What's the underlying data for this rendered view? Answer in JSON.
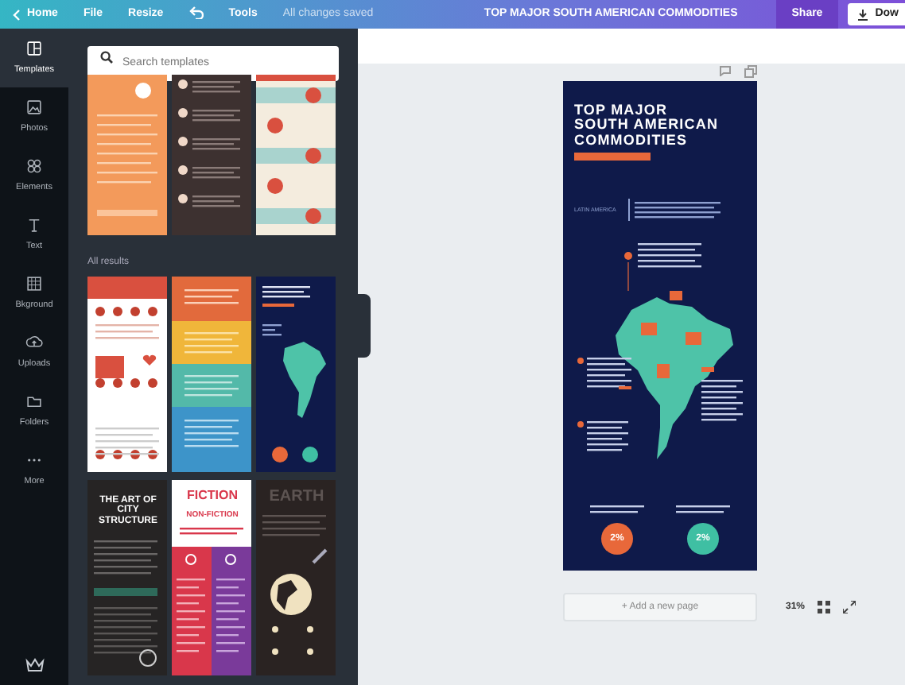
{
  "top_bar": {
    "back": "Home",
    "menu": [
      "File",
      "Resize"
    ],
    "tools": "Tools",
    "save_status": "All changes saved",
    "title": "TOP MAJOR SOUTH AMERICAN COMMODITIES",
    "share": "Share",
    "download": "Dow"
  },
  "sidebar": {
    "items": [
      {
        "label": "Templates",
        "kind": "templates",
        "selected": true
      },
      {
        "label": "Photos",
        "kind": "photos",
        "selected": false
      },
      {
        "label": "Elements",
        "kind": "elements",
        "selected": false
      },
      {
        "label": "Text",
        "kind": "text",
        "selected": false
      },
      {
        "label": "Bkground",
        "kind": "background",
        "selected": false
      },
      {
        "label": "Uploads",
        "kind": "uploads",
        "selected": false
      },
      {
        "label": "Folders",
        "kind": "folders",
        "selected": false
      },
      {
        "label": "More",
        "kind": "more",
        "selected": false
      }
    ]
  },
  "templates_panel": {
    "search": {
      "placeholder": "Search templates"
    },
    "section_label": "All results",
    "featured": [
      {
        "kind": "orange"
      },
      {
        "kind": "list"
      },
      {
        "kind": "mint"
      }
    ],
    "results": [
      {
        "kind": "dots"
      },
      {
        "kind": "stripes"
      },
      {
        "kind": "map"
      },
      {
        "kind": "city",
        "title": "THE ART OF CITY STRUCTURE"
      },
      {
        "kind": "fiction",
        "title": "FICTION",
        "subtitle": "NON-FICTION"
      },
      {
        "kind": "earth",
        "title": "EARTH"
      }
    ]
  },
  "canvas": {
    "page": {
      "title": "TOP MAJOR SOUTH AMERICAN COMMODITIES",
      "region": "LATIN AMERICA",
      "stats": [
        {
          "value": "2%",
          "color": "#e8683a"
        },
        {
          "value": "2%",
          "color": "#3fbfa3"
        }
      ]
    },
    "add_page": "+ Add a new page",
    "zoom": "31%"
  }
}
